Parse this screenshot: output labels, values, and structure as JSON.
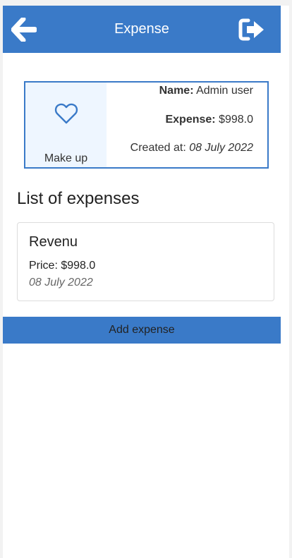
{
  "header": {
    "title": "Expense",
    "back_icon": "arrow-left-icon",
    "logout_icon": "sign-out-icon",
    "color": "#3a7ac8"
  },
  "summary": {
    "category": "Make up",
    "category_icon": "heart-icon",
    "name_label": "Name:",
    "name_value": "Admin user",
    "expense_label": "Expense:",
    "expense_value": "$998.0",
    "created_label": "Created at:",
    "created_value": "08 July 2022"
  },
  "list": {
    "title": "List of expenses",
    "items": [
      {
        "title": "Revenu",
        "price": "Price: $998.0",
        "date": "08 July 2022"
      }
    ]
  },
  "actions": {
    "add_label": "Add expense"
  }
}
